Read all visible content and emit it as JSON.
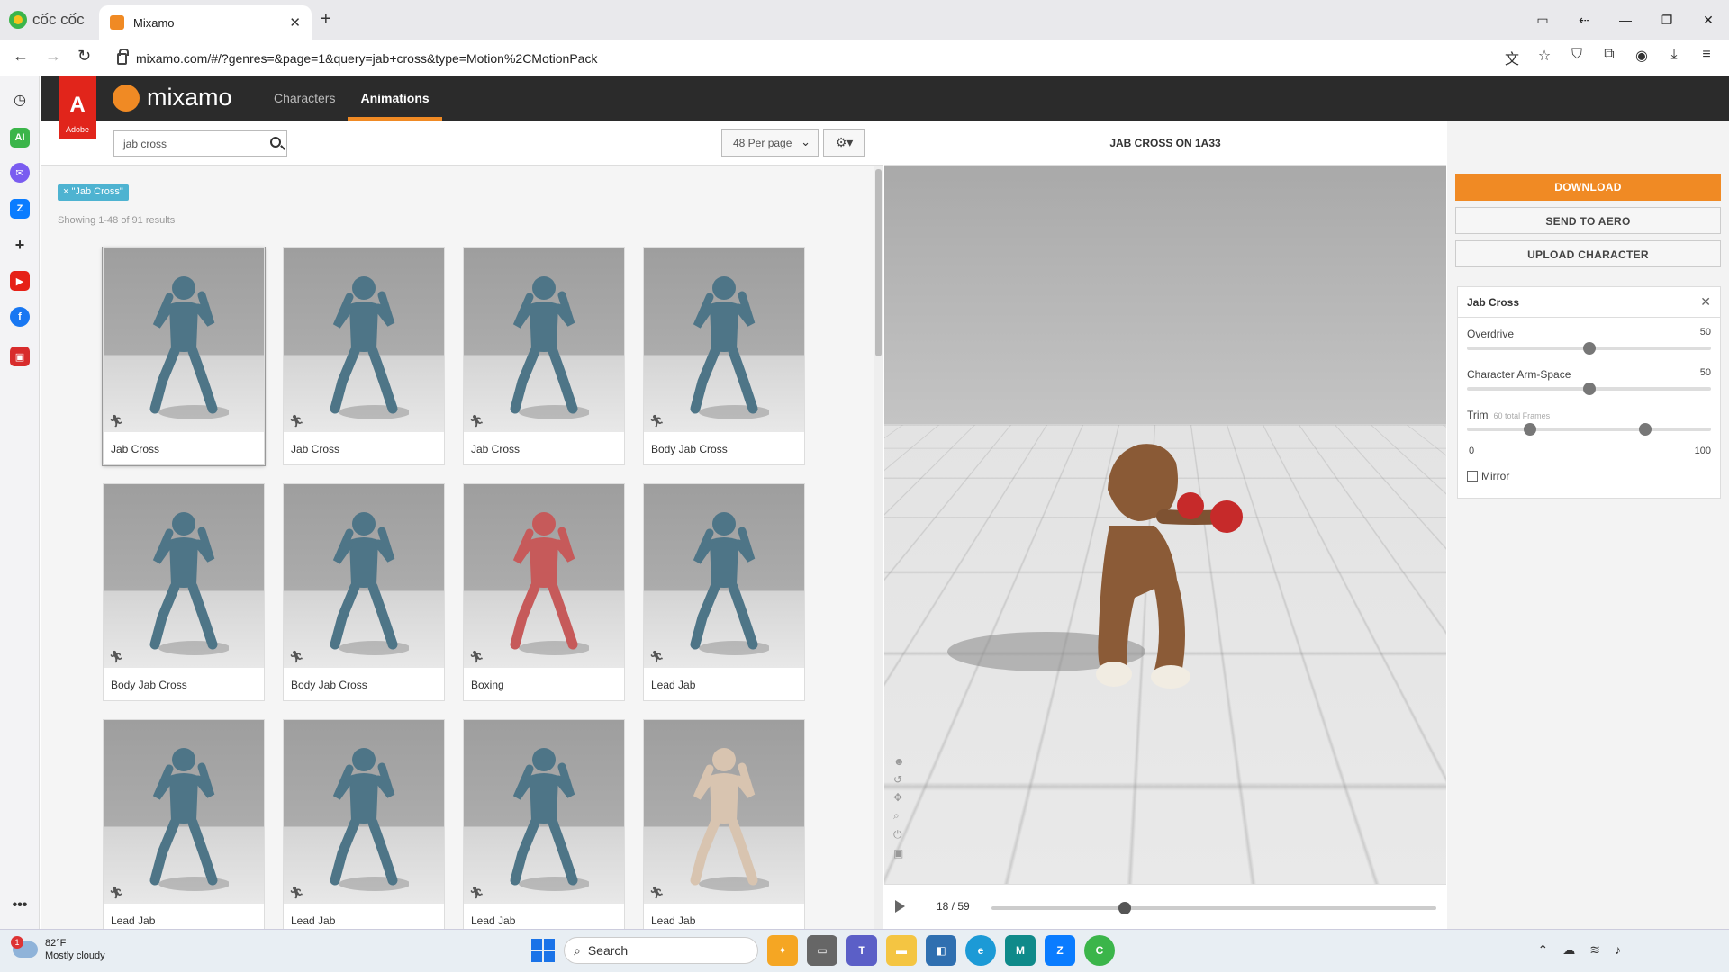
{
  "browser": {
    "brand": "cốc cốc",
    "tab_title": "Mixamo",
    "url": "mixamo.com/#/?genres=&page=1&query=jab+cross&type=Motion%2CMotionPack"
  },
  "mixamo": {
    "adobe_label": "Adobe",
    "logo_text": "mixamo",
    "nav": [
      "Characters",
      "Animations"
    ],
    "search_value": "jab cross",
    "per_page": "48 Per page",
    "filter_chip": "× \"Jab Cross\"",
    "results_text": "Showing 1-48 of 91 results",
    "cards": [
      {
        "label": "Jab Cross",
        "tint": "#4e7587"
      },
      {
        "label": "Jab Cross",
        "tint": "#4e7587"
      },
      {
        "label": "Jab Cross",
        "tint": "#4e7587"
      },
      {
        "label": "Body Jab Cross",
        "tint": "#4e7587"
      },
      {
        "label": "Body Jab Cross",
        "tint": "#4e7587"
      },
      {
        "label": "Body Jab Cross",
        "tint": "#4e7587"
      },
      {
        "label": "Boxing",
        "tint": "#c65a5a"
      },
      {
        "label": "Lead Jab",
        "tint": "#4e7587"
      },
      {
        "label": "Lead Jab",
        "tint": "#4e7587"
      },
      {
        "label": "Lead Jab",
        "tint": "#4e7587"
      },
      {
        "label": "Lead Jab",
        "tint": "#4e7587"
      },
      {
        "label": "Lead Jab",
        "tint": "#d8c4b0"
      }
    ]
  },
  "viewer": {
    "title": "JAB CROSS ON 1A33",
    "current_frame": "18",
    "total_frames": "59",
    "frame_text": "18 / 59",
    "scrub_fraction": 0.3
  },
  "panel": {
    "download": "DOWNLOAD",
    "send_to_aero": "SEND TO AERO",
    "upload_character": "UPLOAD CHARACTER",
    "settings_title": "Jab Cross",
    "overdrive_label": "Overdrive",
    "overdrive_value": "50",
    "armspace_label": "Character Arm-Space",
    "armspace_value": "50",
    "trim_label": "Trim",
    "trim_sub": "60 total Frames",
    "trim_min": "0",
    "trim_max": "100",
    "mirror_label": "Mirror"
  },
  "taskbar": {
    "temp": "82°F",
    "weather": "Mostly cloudy",
    "search_placeholder": "Search",
    "weather_badge": "1"
  },
  "colors": {
    "accent": "#f08a24",
    "adobe_red": "#e1251b",
    "chip_blue": "#4eb3d1"
  }
}
